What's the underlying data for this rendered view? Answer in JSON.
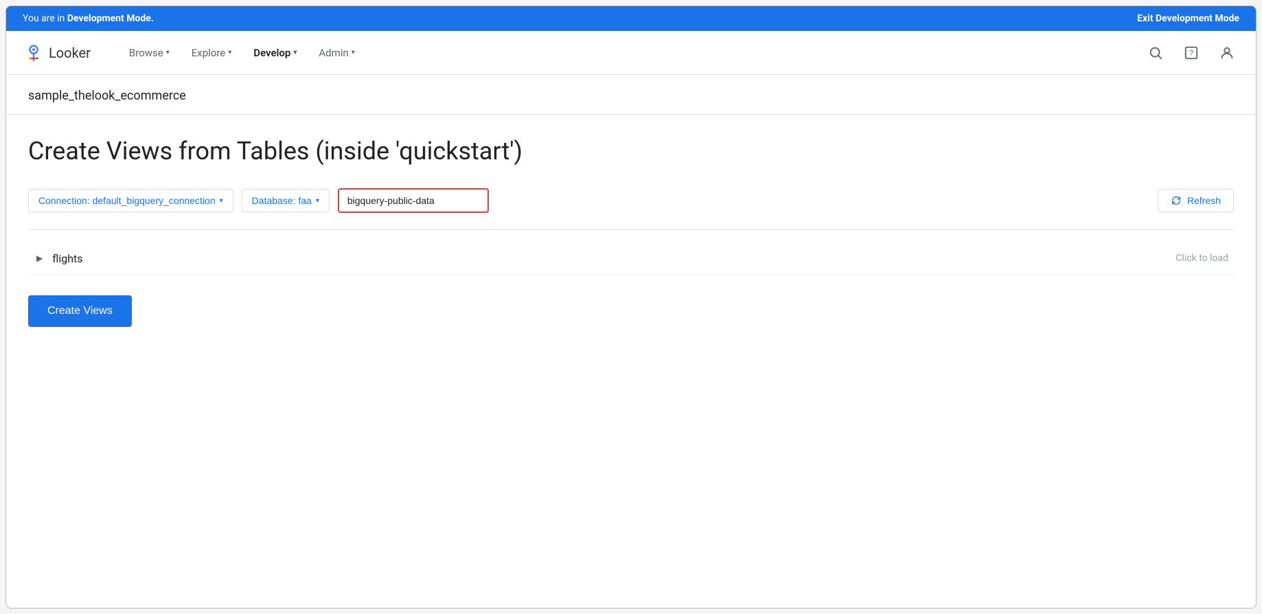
{
  "dev_banner": {
    "message_prefix": "You are in ",
    "message_bold": "Development Mode.",
    "exit_label": "Exit Development Mode"
  },
  "nav": {
    "logo_text": "Looker",
    "items": [
      {
        "label": "Browse",
        "active": false
      },
      {
        "label": "Explore",
        "active": false
      },
      {
        "label": "Develop",
        "active": true
      },
      {
        "label": "Admin",
        "active": false
      }
    ],
    "icons": [
      {
        "name": "search-icon",
        "symbol": "🔍"
      },
      {
        "name": "help-icon",
        "symbol": "?"
      },
      {
        "name": "user-icon",
        "symbol": "👤"
      }
    ]
  },
  "project": {
    "name": "sample_thelook_ecommerce"
  },
  "page": {
    "title": "Create Views from Tables (inside 'quickstart')"
  },
  "controls": {
    "connection_label": "Connection: default_bigquery_connection",
    "database_label": "Database: faa",
    "schema_placeholder": "bigquery-public-data",
    "schema_value": "bigquery-public-data",
    "refresh_label": "Refresh"
  },
  "tables": [
    {
      "name": "flights",
      "click_to_load": "Click to load"
    }
  ],
  "create_views_button": "Create Views"
}
